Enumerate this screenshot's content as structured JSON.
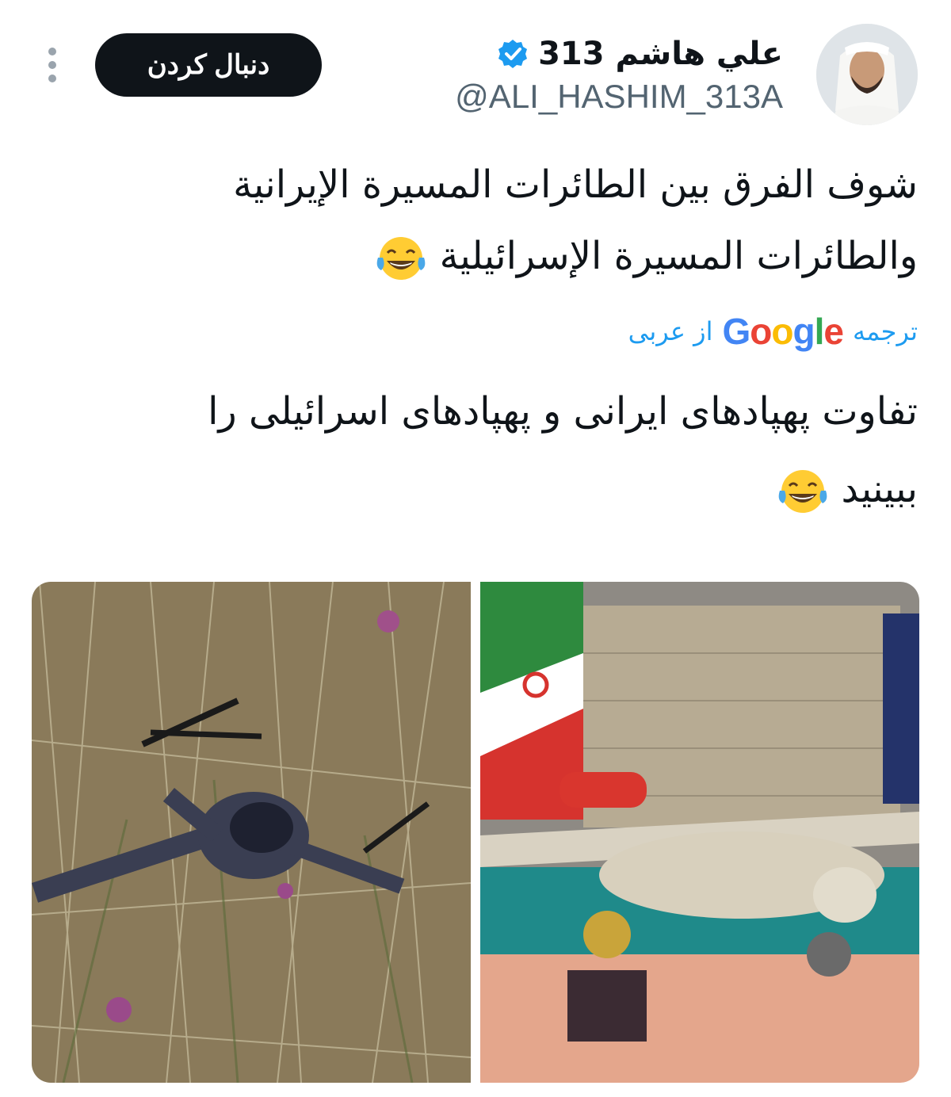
{
  "profile": {
    "display_name": "علي هاشم 313",
    "handle": "@ALI_HASHIM_313A",
    "verified": true,
    "follow_label": "دنبال کردن"
  },
  "tweet": {
    "line1": "شوف الفرق بين الطائرات المسيرة الإيرانية",
    "line2": "والطائرات المسيرة الإسرائيلية",
    "emoji": "laughing-tears-icon"
  },
  "translation": {
    "prefix": "ترجمه",
    "brand": "Google",
    "suffix": "از عربی",
    "line1": "تفاوت پهپادهای ایرانی و پهپادهای اسرائیلی را",
    "line2": "ببینید"
  },
  "colors": {
    "link": "#1d9bf0",
    "verified": "#1d9bf0",
    "button_bg": "#0f1419",
    "secondary_text": "#536471"
  },
  "media": {
    "left_image": "small-quadcopter-drone-in-grass",
    "right_image": "large-fixed-wing-drone-at-exhibition"
  }
}
